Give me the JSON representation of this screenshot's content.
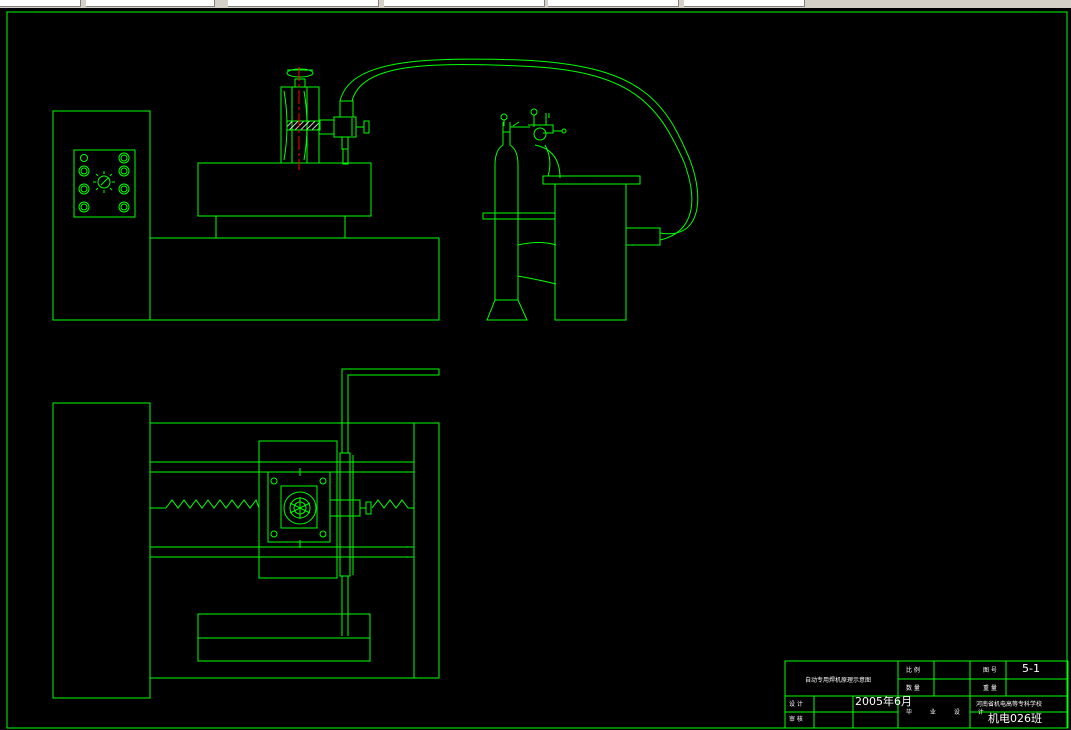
{
  "colors": {
    "background": "#000000",
    "line": "#00ff00",
    "centerline": "#ff0000",
    "text": "#ffffff"
  },
  "title_block": {
    "drawing_title": "自动专用焊机原理示意图",
    "ratio_label": "比 例",
    "quantity_label": "数 量",
    "sheet_no_label": "图 号",
    "sheet_no_value": "5-1",
    "weight_label": "重 量",
    "designer_label": "设 计",
    "date_value": "2005年6月",
    "reviewer_label": "审 核",
    "graduation_design_label": "毕 业 设 计",
    "school_name": "河南省机电高等专科学校",
    "class_value": "机电026班"
  }
}
